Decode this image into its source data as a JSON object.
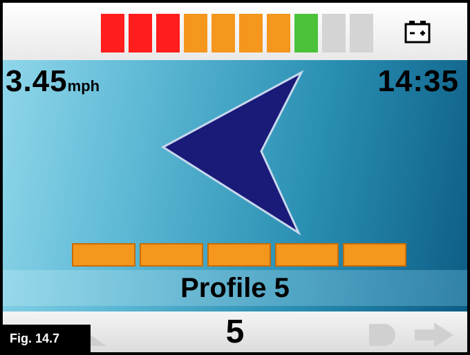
{
  "battery": {
    "segments": [
      {
        "color": "#ff1d1d"
      },
      {
        "color": "#ff1d1d"
      },
      {
        "color": "#ff1d1d"
      },
      {
        "color": "#f5961d"
      },
      {
        "color": "#f5961d"
      },
      {
        "color": "#f5961d"
      },
      {
        "color": "#f5961d"
      },
      {
        "color": "#4bc23a"
      },
      {
        "color": "#d4d4d4"
      },
      {
        "color": "#d4d4d4"
      }
    ],
    "icon": "battery-icon"
  },
  "status": {
    "speed_value": "3.45",
    "speed_unit": "mph",
    "time": "14:35"
  },
  "direction": {
    "icon": "left-arrow-icon"
  },
  "profile": {
    "bars_count": 5,
    "bar_color": "#f5961d",
    "label": "Profile 5"
  },
  "bottom": {
    "mode_number": "5",
    "left_icon": "faded-seat-icon",
    "right_icon": "faded-light-arrow-icon"
  },
  "figure_label": "Fig. 14.7"
}
